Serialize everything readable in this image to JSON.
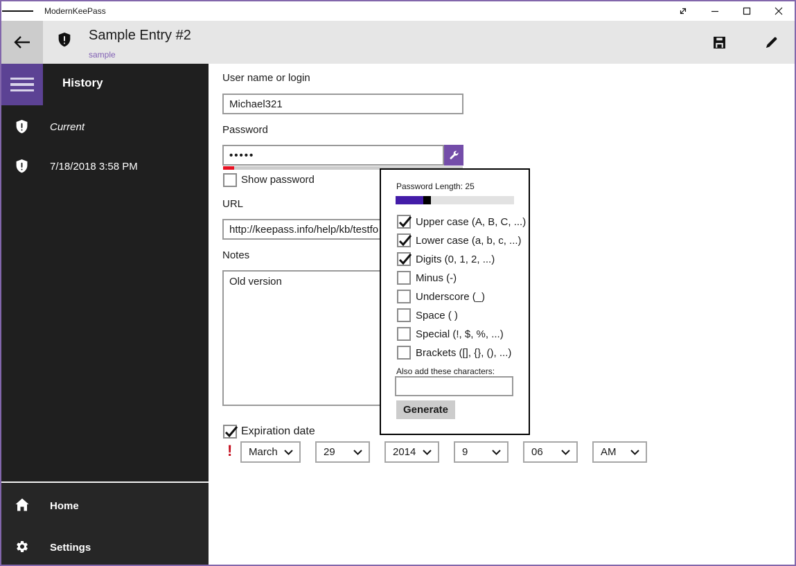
{
  "titlebar": {
    "app_name": "ModernKeePass"
  },
  "header": {
    "title": "Sample Entry #2",
    "subtitle": "sample"
  },
  "sidebar": {
    "heading": "History",
    "items": [
      {
        "label": "Current"
      },
      {
        "label": "7/18/2018 3:58 PM"
      }
    ],
    "bottom_items": [
      {
        "label": "Home"
      },
      {
        "label": "Settings"
      }
    ]
  },
  "form": {
    "username_label": "User name or login",
    "username_value": "Michael321",
    "password_label": "Password",
    "password_value": "•••••",
    "show_password_label": "Show password",
    "show_password_checked": false,
    "url_label": "URL",
    "url_value": "http://keepass.info/help/kb/testfo",
    "notes_label": "Notes",
    "notes_value": "Old version",
    "expiration_label": "Expiration date",
    "expiration_checked": true,
    "expiration_alert": "!",
    "date_parts": [
      {
        "name": "month",
        "value": "March"
      },
      {
        "name": "day",
        "value": "29"
      },
      {
        "name": "year",
        "value": "2014"
      },
      {
        "name": "hour",
        "value": "9"
      },
      {
        "name": "minute",
        "value": "06"
      },
      {
        "name": "ampm",
        "value": "AM"
      }
    ]
  },
  "generator": {
    "length_label": "Password Length: 25",
    "length_value": 25,
    "options": [
      {
        "label": "Upper case (A, B, C, ...)",
        "checked": true
      },
      {
        "label": "Lower case (a, b, c, ...)",
        "checked": true
      },
      {
        "label": "Digits (0, 1, 2, ...)",
        "checked": true
      },
      {
        "label": "Minus (-)",
        "checked": false
      },
      {
        "label": "Underscore (_)",
        "checked": false
      },
      {
        "label": "Space ( )",
        "checked": false
      },
      {
        "label": "Special (!, $, %, ...)",
        "checked": false
      },
      {
        "label": "Brackets ([], {}, (), ...)",
        "checked": false
      }
    ],
    "also_add_label": "Also add these characters:",
    "also_add_value": "",
    "generate_label": "Generate"
  },
  "colors": {
    "window_border": "#8266ab",
    "accent_button": "#744da9",
    "nav_burger": "#5c4294",
    "slider_fill": "#431ca8",
    "strength_red": "#e81123",
    "header_bg": "#e6e6e6",
    "sidebar_bg": "#1f1f1f",
    "subtitle_purple": "#8160b4"
  }
}
